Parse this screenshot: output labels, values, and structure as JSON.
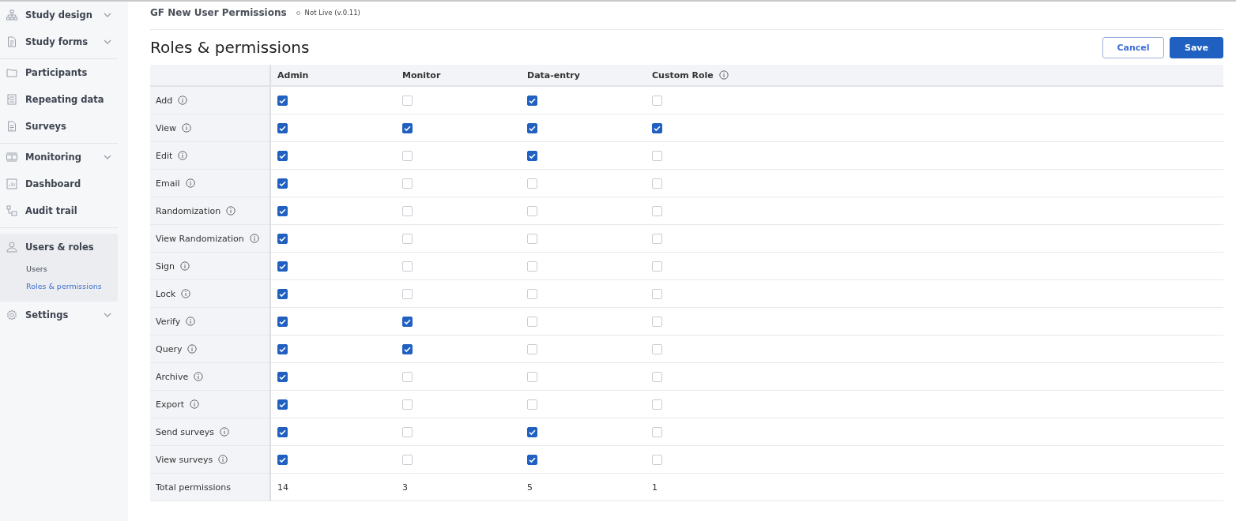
{
  "sidebar": {
    "groups": [
      {
        "items": [
          {
            "label": "Study design",
            "expanded": false
          },
          {
            "label": "Study forms",
            "expanded": false
          }
        ]
      },
      {
        "items": [
          {
            "label": "Participants"
          },
          {
            "label": "Repeating data"
          },
          {
            "label": "Surveys"
          }
        ]
      },
      {
        "items": [
          {
            "label": "Monitoring",
            "expanded": false
          },
          {
            "label": "Dashboard"
          },
          {
            "label": "Audit trail"
          }
        ]
      },
      {
        "items": [
          {
            "label": "Users & roles",
            "expanded": true,
            "children": [
              {
                "label": "Users",
                "selected": false
              },
              {
                "label": "Roles & permissions",
                "selected": true
              }
            ]
          }
        ]
      },
      {
        "items": [
          {
            "label": "Settings",
            "expanded": false
          }
        ]
      }
    ]
  },
  "header": {
    "study": "GF New User Permissions",
    "status": "Not Live (v.0.11)"
  },
  "page": {
    "title": "Roles & permissions",
    "buttons": [
      {
        "label": "Cancel",
        "kind": "secondary"
      },
      {
        "label": "Save",
        "kind": "primary"
      }
    ]
  },
  "table": {
    "columns": [
      {
        "label": "Admin",
        "info": false
      },
      {
        "label": "Monitor",
        "info": false
      },
      {
        "label": "Data-entry",
        "info": false
      },
      {
        "label": "Custom Role",
        "info": true
      }
    ],
    "rows": [
      {
        "label": "Add",
        "checked": [
          true,
          false,
          true,
          false
        ]
      },
      {
        "label": "View",
        "checked": [
          true,
          true,
          true,
          true
        ]
      },
      {
        "label": "Edit",
        "checked": [
          true,
          false,
          true,
          false
        ]
      },
      {
        "label": "Email",
        "checked": [
          true,
          false,
          false,
          false
        ]
      },
      {
        "label": "Randomization",
        "checked": [
          true,
          false,
          false,
          false
        ]
      },
      {
        "label": "View Randomization",
        "checked": [
          true,
          false,
          false,
          false
        ]
      },
      {
        "label": "Sign",
        "checked": [
          true,
          false,
          false,
          false
        ]
      },
      {
        "label": "Lock",
        "checked": [
          true,
          false,
          false,
          false
        ]
      },
      {
        "label": "Verify",
        "checked": [
          true,
          true,
          false,
          false
        ]
      },
      {
        "label": "Query",
        "checked": [
          true,
          true,
          false,
          false
        ]
      },
      {
        "label": "Archive",
        "checked": [
          true,
          false,
          false,
          false
        ]
      },
      {
        "label": "Export",
        "checked": [
          true,
          false,
          false,
          false
        ]
      },
      {
        "label": "Send surveys",
        "checked": [
          true,
          false,
          true,
          false
        ]
      },
      {
        "label": "View surveys",
        "checked": [
          true,
          false,
          true,
          false
        ]
      }
    ],
    "total": {
      "label": "Total permissions",
      "values": [
        "14",
        "3",
        "5",
        "1"
      ]
    }
  }
}
